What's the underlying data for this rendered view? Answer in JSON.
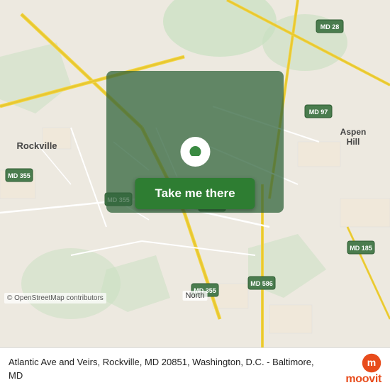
{
  "map": {
    "credit": "© OpenStreetMap contributors",
    "north_label": "North"
  },
  "button": {
    "label": "Take me there"
  },
  "bottom_bar": {
    "address": "Atlantic Ave and Veirs, Rockville, MD 20851,\nWashington, D.C. - Baltimore, MD"
  },
  "moovit": {
    "wordmark": "moovit"
  },
  "road_labels": [
    "MD 355",
    "MD 355",
    "MD 355",
    "MD 586",
    "MD 586",
    "MD 28",
    "MD 97",
    "MD 185"
  ],
  "place_labels": [
    "Rockville",
    "Aspen Hill"
  ]
}
